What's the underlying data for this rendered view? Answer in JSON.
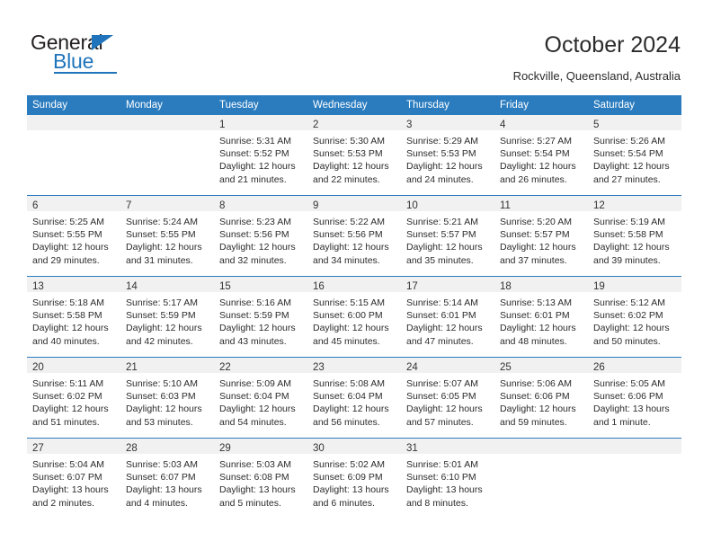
{
  "brand": {
    "word_one": "General",
    "word_two": "Blue",
    "triangle_icon": "blue-triangle-icon"
  },
  "header": {
    "title": "October 2024",
    "subtitle": "Rockville, Queensland, Australia"
  },
  "colors": {
    "header_blue": "#2b7cbf",
    "brand_blue": "#1f74bb",
    "daynum_band": "#f1f1f1",
    "text": "#2b2b2b"
  },
  "weekday_headers": [
    "Sunday",
    "Monday",
    "Tuesday",
    "Wednesday",
    "Thursday",
    "Friday",
    "Saturday"
  ],
  "labels": {
    "sunrise_prefix": "Sunrise:",
    "sunset_prefix": "Sunset:",
    "daylight_prefix": "Daylight:"
  },
  "weeks": [
    [
      {
        "day": "",
        "empty": true
      },
      {
        "day": "",
        "empty": true
      },
      {
        "day": "1",
        "sunrise": "Sunrise: 5:31 AM",
        "sunset": "Sunset: 5:52 PM",
        "daylight": "Daylight: 12 hours and 21 minutes."
      },
      {
        "day": "2",
        "sunrise": "Sunrise: 5:30 AM",
        "sunset": "Sunset: 5:53 PM",
        "daylight": "Daylight: 12 hours and 22 minutes."
      },
      {
        "day": "3",
        "sunrise": "Sunrise: 5:29 AM",
        "sunset": "Sunset: 5:53 PM",
        "daylight": "Daylight: 12 hours and 24 minutes."
      },
      {
        "day": "4",
        "sunrise": "Sunrise: 5:27 AM",
        "sunset": "Sunset: 5:54 PM",
        "daylight": "Daylight: 12 hours and 26 minutes."
      },
      {
        "day": "5",
        "sunrise": "Sunrise: 5:26 AM",
        "sunset": "Sunset: 5:54 PM",
        "daylight": "Daylight: 12 hours and 27 minutes."
      }
    ],
    [
      {
        "day": "6",
        "sunrise": "Sunrise: 5:25 AM",
        "sunset": "Sunset: 5:55 PM",
        "daylight": "Daylight: 12 hours and 29 minutes."
      },
      {
        "day": "7",
        "sunrise": "Sunrise: 5:24 AM",
        "sunset": "Sunset: 5:55 PM",
        "daylight": "Daylight: 12 hours and 31 minutes."
      },
      {
        "day": "8",
        "sunrise": "Sunrise: 5:23 AM",
        "sunset": "Sunset: 5:56 PM",
        "daylight": "Daylight: 12 hours and 32 minutes."
      },
      {
        "day": "9",
        "sunrise": "Sunrise: 5:22 AM",
        "sunset": "Sunset: 5:56 PM",
        "daylight": "Daylight: 12 hours and 34 minutes."
      },
      {
        "day": "10",
        "sunrise": "Sunrise: 5:21 AM",
        "sunset": "Sunset: 5:57 PM",
        "daylight": "Daylight: 12 hours and 35 minutes."
      },
      {
        "day": "11",
        "sunrise": "Sunrise: 5:20 AM",
        "sunset": "Sunset: 5:57 PM",
        "daylight": "Daylight: 12 hours and 37 minutes."
      },
      {
        "day": "12",
        "sunrise": "Sunrise: 5:19 AM",
        "sunset": "Sunset: 5:58 PM",
        "daylight": "Daylight: 12 hours and 39 minutes."
      }
    ],
    [
      {
        "day": "13",
        "sunrise": "Sunrise: 5:18 AM",
        "sunset": "Sunset: 5:58 PM",
        "daylight": "Daylight: 12 hours and 40 minutes."
      },
      {
        "day": "14",
        "sunrise": "Sunrise: 5:17 AM",
        "sunset": "Sunset: 5:59 PM",
        "daylight": "Daylight: 12 hours and 42 minutes."
      },
      {
        "day": "15",
        "sunrise": "Sunrise: 5:16 AM",
        "sunset": "Sunset: 5:59 PM",
        "daylight": "Daylight: 12 hours and 43 minutes."
      },
      {
        "day": "16",
        "sunrise": "Sunrise: 5:15 AM",
        "sunset": "Sunset: 6:00 PM",
        "daylight": "Daylight: 12 hours and 45 minutes."
      },
      {
        "day": "17",
        "sunrise": "Sunrise: 5:14 AM",
        "sunset": "Sunset: 6:01 PM",
        "daylight": "Daylight: 12 hours and 47 minutes."
      },
      {
        "day": "18",
        "sunrise": "Sunrise: 5:13 AM",
        "sunset": "Sunset: 6:01 PM",
        "daylight": "Daylight: 12 hours and 48 minutes."
      },
      {
        "day": "19",
        "sunrise": "Sunrise: 5:12 AM",
        "sunset": "Sunset: 6:02 PM",
        "daylight": "Daylight: 12 hours and 50 minutes."
      }
    ],
    [
      {
        "day": "20",
        "sunrise": "Sunrise: 5:11 AM",
        "sunset": "Sunset: 6:02 PM",
        "daylight": "Daylight: 12 hours and 51 minutes."
      },
      {
        "day": "21",
        "sunrise": "Sunrise: 5:10 AM",
        "sunset": "Sunset: 6:03 PM",
        "daylight": "Daylight: 12 hours and 53 minutes."
      },
      {
        "day": "22",
        "sunrise": "Sunrise: 5:09 AM",
        "sunset": "Sunset: 6:04 PM",
        "daylight": "Daylight: 12 hours and 54 minutes."
      },
      {
        "day": "23",
        "sunrise": "Sunrise: 5:08 AM",
        "sunset": "Sunset: 6:04 PM",
        "daylight": "Daylight: 12 hours and 56 minutes."
      },
      {
        "day": "24",
        "sunrise": "Sunrise: 5:07 AM",
        "sunset": "Sunset: 6:05 PM",
        "daylight": "Daylight: 12 hours and 57 minutes."
      },
      {
        "day": "25",
        "sunrise": "Sunrise: 5:06 AM",
        "sunset": "Sunset: 6:06 PM",
        "daylight": "Daylight: 12 hours and 59 minutes."
      },
      {
        "day": "26",
        "sunrise": "Sunrise: 5:05 AM",
        "sunset": "Sunset: 6:06 PM",
        "daylight": "Daylight: 13 hours and 1 minute."
      }
    ],
    [
      {
        "day": "27",
        "sunrise": "Sunrise: 5:04 AM",
        "sunset": "Sunset: 6:07 PM",
        "daylight": "Daylight: 13 hours and 2 minutes."
      },
      {
        "day": "28",
        "sunrise": "Sunrise: 5:03 AM",
        "sunset": "Sunset: 6:07 PM",
        "daylight": "Daylight: 13 hours and 4 minutes."
      },
      {
        "day": "29",
        "sunrise": "Sunrise: 5:03 AM",
        "sunset": "Sunset: 6:08 PM",
        "daylight": "Daylight: 13 hours and 5 minutes."
      },
      {
        "day": "30",
        "sunrise": "Sunrise: 5:02 AM",
        "sunset": "Sunset: 6:09 PM",
        "daylight": "Daylight: 13 hours and 6 minutes."
      },
      {
        "day": "31",
        "sunrise": "Sunrise: 5:01 AM",
        "sunset": "Sunset: 6:10 PM",
        "daylight": "Daylight: 13 hours and 8 minutes."
      },
      {
        "day": "",
        "empty": true
      },
      {
        "day": "",
        "empty": true
      }
    ]
  ]
}
